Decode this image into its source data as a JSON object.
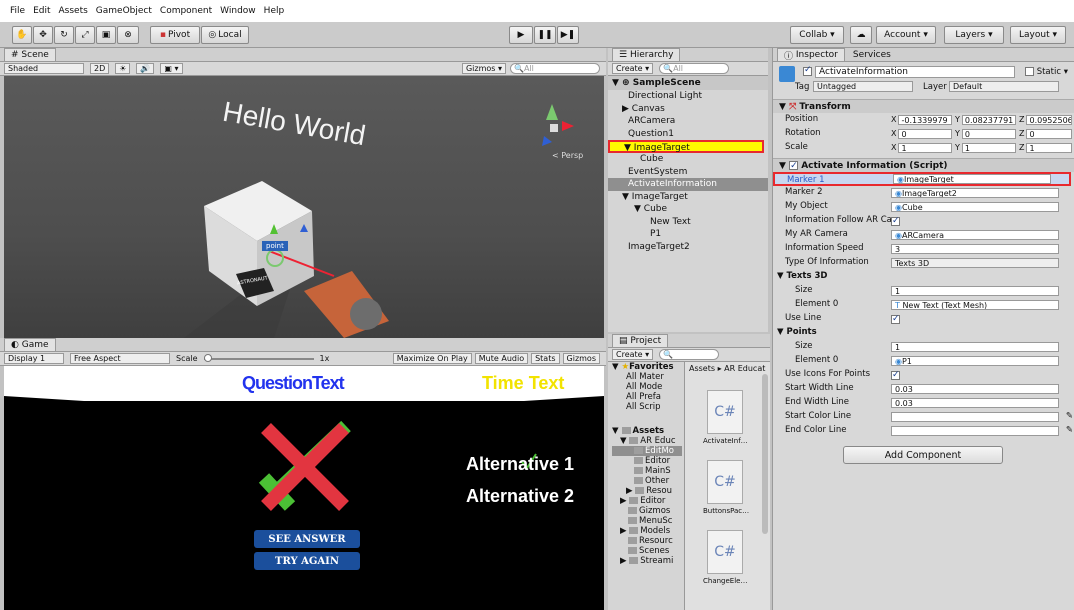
{
  "menu": [
    "File",
    "Edit",
    "Assets",
    "GameObject",
    "Component",
    "Window",
    "Help"
  ],
  "toolbar": {
    "pivot": "Pivot",
    "local": "Local",
    "collab": "Collab ▾",
    "account": "Account",
    "layers": "Layers",
    "layout": "Layout"
  },
  "scene": {
    "tab": "Scene",
    "shading": "Shaded",
    "mode2d": "2D",
    "gizmos": "Gizmos ▾",
    "search_placeholder": "All",
    "world_text": "Hello World",
    "persp": "< Persp",
    "point_label": "point",
    "card_label": "ASTRONAUT"
  },
  "game": {
    "tab": "Game",
    "display": "Display 1",
    "aspect": "Free Aspect",
    "scale_label": "Scale",
    "scale_value": "1x",
    "maximize": "Maximize On Play",
    "mute": "Mute Audio",
    "stats": "Stats",
    "gizmos": "Gizmos",
    "question_text": "QuestionText",
    "time_text": "Time Text",
    "alt1": "Alternative 1",
    "alt2": "Alternative 2",
    "see_answer": "SEE ANSWER",
    "try_again": "TRY AGAIN"
  },
  "hierarchy": {
    "tab": "Hierarchy",
    "create": "Create ▾",
    "search_placeholder": "All",
    "scene_name": "SampleScene",
    "items": [
      "Directional Light",
      "Canvas",
      "ARCamera",
      "Question1",
      "ImageTarget",
      "Cube",
      "EventSystem",
      "ActivateInformation",
      "ImageTarget",
      "Cube",
      "New Text",
      "P1",
      "ImageTarget2"
    ]
  },
  "project": {
    "tab": "Project",
    "create": "Create ▾",
    "breadcrumb": "Assets ▸ AR Educat",
    "favorites_label": "Favorites",
    "favorites": [
      "All Mater",
      "All Mode",
      "All Prefa",
      "All Scrip"
    ],
    "assets_label": "Assets",
    "assets": [
      "AR Educ",
      "EditMo",
      "Editor",
      "MainS",
      "Other",
      "Resou",
      "Editor",
      "Gizmos",
      "MenuSc",
      "Models",
      "Resourc",
      "Scenes",
      "Streami"
    ],
    "files": [
      "ActivateInf…",
      "ButtonsPac…",
      "ChangeEle…"
    ]
  },
  "inspector": {
    "tab": "Inspector",
    "services_tab": "Services",
    "object_name": "ActivateInformation",
    "static": "Static",
    "tag_label": "Tag",
    "tag": "Untagged",
    "layer_label": "Layer",
    "layer": "Default",
    "transform": {
      "title": "Transform",
      "position_label": "Position",
      "position": [
        "-0.1339979",
        "0.08237791",
        "0.09525061"
      ],
      "rotation_label": "Rotation",
      "rotation": [
        "0",
        "0",
        "0"
      ],
      "scale_label": "Scale",
      "scale": [
        "1",
        "1",
        "1"
      ]
    },
    "script": {
      "title": "Activate Information (Script)",
      "rows": [
        {
          "label": "Marker 1",
          "value": "ImageTarget"
        },
        {
          "label": "Marker 2",
          "value": "ImageTarget2"
        },
        {
          "label": "My Object",
          "value": "Cube"
        },
        {
          "label": "Information Follow AR Cam",
          "value": ""
        },
        {
          "label": "My AR Camera",
          "value": "ARCamera"
        },
        {
          "label": "Information Speed",
          "value": "3"
        },
        {
          "label": "Type Of Information",
          "value": "Texts 3D"
        }
      ],
      "texts3d_label": "Texts 3D",
      "size_label": "Size",
      "texts_size": "1",
      "element0_label": "Element 0",
      "texts_element0": "New Text (Text Mesh)",
      "use_line_label": "Use Line",
      "points_label": "Points",
      "points_size": "1",
      "points_element0": "P1",
      "use_icons_label": "Use Icons For Points",
      "start_width_label": "Start Width Line",
      "start_width": "0.03",
      "end_width_label": "End Width Line",
      "end_width": "0.03",
      "start_color_label": "Start Color Line",
      "end_color_label": "End Color Line"
    },
    "add_component": "Add Component"
  },
  "colors": {
    "highlight": "#e8292e",
    "selected_row": "#3e7de0",
    "game_bg": "#000000"
  }
}
